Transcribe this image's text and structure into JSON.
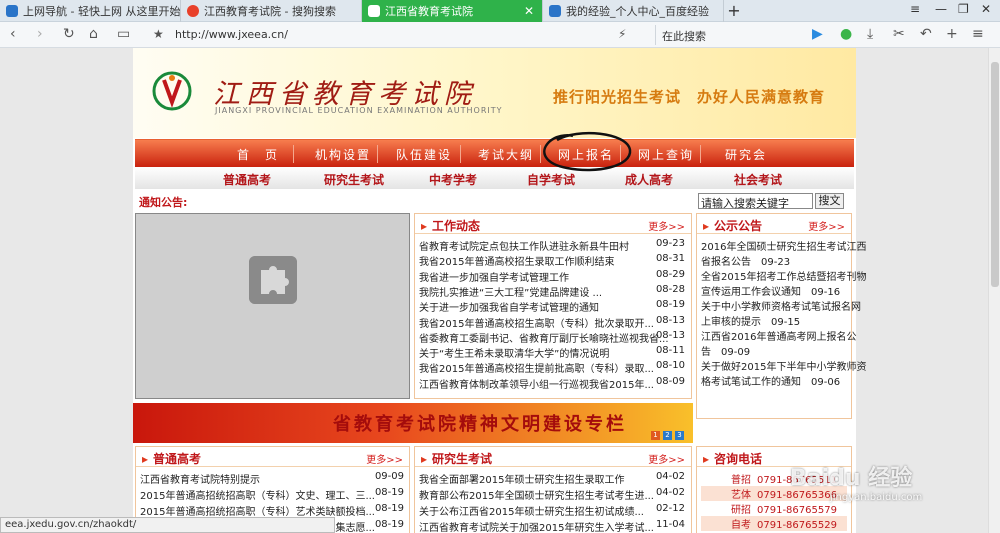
{
  "tabs": [
    {
      "title": "上网导航 - 轻快上网 从这里开始",
      "color": "#2a74c8"
    },
    {
      "title": "江西教育考试院 - 搜狗搜索",
      "color": "#e8402a"
    },
    {
      "title": "江西省教育考试院",
      "color": "#ffffff"
    },
    {
      "title": "我的经验_个人中心_百度经验",
      "color": "#2a74c8"
    }
  ],
  "browser": {
    "url": "http://www.jxeea.cn/",
    "search_placeholder": "在此搜索",
    "status_url": "eea.jxedu.gov.cn/zhaokdt/"
  },
  "site": {
    "name": "江西省教育考试院",
    "english": "JIANGXI PROVINCIAL EDUCATION EXAMINATION AUTHORITY",
    "slogan": "推行阳光招生考试　办好人民满意教育",
    "menu1": [
      "首　页",
      "机构设置",
      "队伍建设",
      "考试大纲",
      "网上报名",
      "网上查询",
      "研究会"
    ],
    "menu2": [
      "普通高考",
      "研究生考试",
      "中考学考",
      "自学考试",
      "成人高考",
      "社会考试"
    ],
    "notice": "通知公告:",
    "search_value": "请输入搜索关键字",
    "search_btn": "搜文"
  },
  "work": {
    "title": "工作动态",
    "more": "更多>>",
    "items": [
      {
        "t": "省教育考试院定点包扶工作队进驻永新县牛田村",
        "d": "09-23"
      },
      {
        "t": "我省2015年普通高校招生录取工作顺利结束",
        "d": "08-31"
      },
      {
        "t": "我省进一步加强自学考试管理工作",
        "d": "08-29"
      },
      {
        "t": "我院扎实推进“三大工程”党建品牌建设 ...",
        "d": "08-28"
      },
      {
        "t": "关于进一步加强我省自学考试管理的通知",
        "d": "08-19"
      },
      {
        "t": "我省2015年普通高校招生高职（专科）批次录取开...",
        "d": "08-13"
      },
      {
        "t": "省委教育工委副书记、省教育厅副厅长喻晓社巡视我省...",
        "d": "08-13"
      },
      {
        "t": "关于“考生王希未录取清华大学”的情况说明",
        "d": "08-11"
      },
      {
        "t": "我省2015年普通高校招生提前批高职（专科）录取...",
        "d": "08-10"
      },
      {
        "t": "江西省教育体制改革领导小组一行巡视我省2015年...",
        "d": "08-09"
      }
    ]
  },
  "notices": {
    "title": "公示公告",
    "more": "更多>>",
    "items": [
      {
        "l1": "2016年全国硕士研究生招生考试江西",
        "l2": "省报名公告",
        "d": "09-23"
      },
      {
        "l1": "全省2015年招考工作总结暨招考刊物",
        "l2": "宣传运用工作会议通知",
        "d": "09-16"
      },
      {
        "l1": "关于中小学教师资格考试笔试报名网",
        "l2": "上审核的提示",
        "d": "09-15"
      },
      {
        "l1": "江西省2016年普通高考网上报名公",
        "l2": "告",
        "d": "09-09"
      },
      {
        "l1": "关于做好2015年下半年中小学教师资",
        "l2": "格考试笔试工作的通知",
        "d": "09-06"
      }
    ]
  },
  "banner": {
    "text": "省教育考试院精神文明建设专栏",
    "pages": [
      "1",
      "2",
      "3"
    ]
  },
  "gaokao": {
    "title": "普通高考",
    "more": "更多>>",
    "items": [
      {
        "t": "江西省教育考试院特别提示",
        "d": "09-09"
      },
      {
        "t": "2015年普通高招统招高职（专科）文史、理工、三...",
        "d": "08-19"
      },
      {
        "t": "2015年普通高招统招高职（专科）艺术类缺额投档...",
        "d": "08-19"
      },
      {
        "t": "2015年普通高招统招高职（专科）第二次征集志愿...",
        "d": "08-19"
      }
    ]
  },
  "yanjiu": {
    "title": "研究生考试",
    "more": "更多>>",
    "items": [
      {
        "t": "我省全面部署2015年硕士研究生招生录取工作",
        "d": "04-02"
      },
      {
        "t": "教育部公布2015年全国硕士研究生招生考试考生进...",
        "d": "04-02"
      },
      {
        "t": "关于公布江西省2015年硕士研究生招生初试成绩...",
        "d": "02-12"
      },
      {
        "t": "江西省教育考试院关于加强2015年研究生入学考试...",
        "d": "11-04"
      }
    ]
  },
  "consult": {
    "title": "咨询电话",
    "items": [
      {
        "k": "普招",
        "v": "0791-86765511"
      },
      {
        "k": "艺体",
        "v": "0791-86765366"
      },
      {
        "k": "研招",
        "v": "0791-86765579"
      },
      {
        "k": "自考",
        "v": "0791-86765529"
      }
    ]
  },
  "watermark": {
    "brand": "Baidu 经验",
    "url": "jingyan.baidu.com"
  }
}
